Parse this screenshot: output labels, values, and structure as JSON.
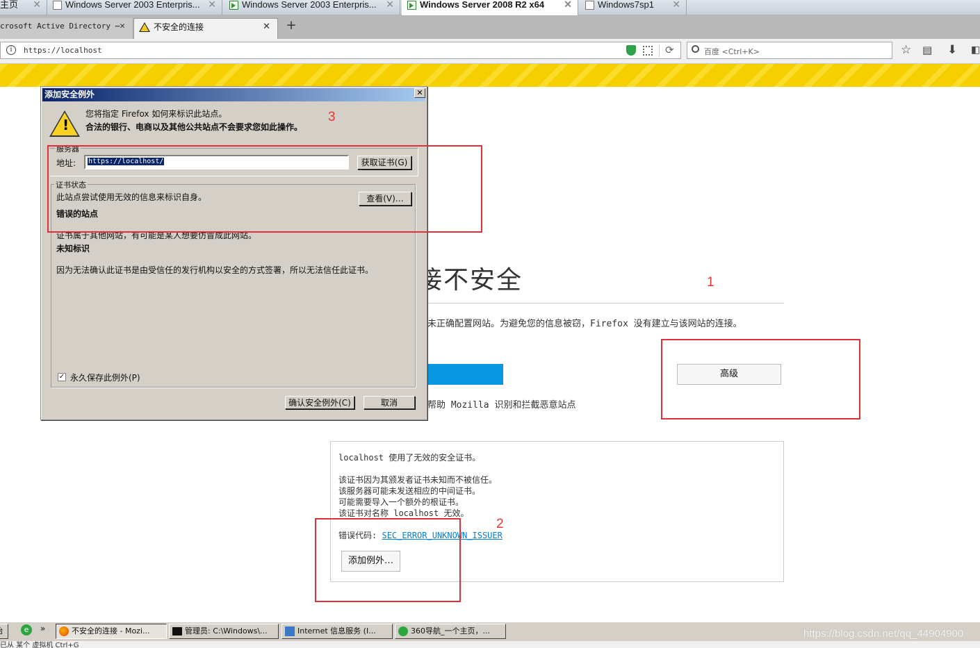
{
  "vm_tabs": [
    {
      "label": "主页"
    },
    {
      "label": "Windows Server 2003 Enterpris..."
    },
    {
      "label": "Windows Server 2003 Enterpris..."
    },
    {
      "label": "Windows Server 2008 R2 x64",
      "active": true
    },
    {
      "label": "Windows7sp1"
    }
  ],
  "browser_tabs": [
    {
      "label": "crosoft Active Directory ⋯"
    },
    {
      "label": "不安全的连接",
      "active": true
    }
  ],
  "new_tab_label": "+",
  "url_bar": {
    "url": "https://localhost"
  },
  "search_bar": {
    "placeholder": "百度 <Ctrl+K>"
  },
  "error_page": {
    "title_partial": "接不安全",
    "description_partial": "未正确配置网站。为避免您的信息被窃，Firefox 没有建立与该网站的连接。",
    "advanced_button": "高级",
    "report_partial": "帮助 Mozilla 识别和拦截恶意站点",
    "advanced_panel": {
      "line1": "localhost 使用了无效的安全证书。",
      "line2": "该证书因为其颁发者证书未知而不被信任。",
      "line3": "该服务器可能未发送相应的中间证书。",
      "line4": "可能需要导入一个额外的根证书。",
      "line5": "该证书对名称 localhost 无效。",
      "error_code_label": "错误代码:",
      "error_code": "SEC_ERROR_UNKNOWN_ISSUER",
      "add_exception_button": "添加例外…"
    }
  },
  "dialog": {
    "title": "添加安全例外",
    "close": "✕",
    "msg1": "您将指定 Firefox 如何来标识此站点。",
    "msg2": "合法的银行、电商以及其他公共站点不会要求您如此操作。",
    "server_group": "服务器",
    "address_label": "地址:",
    "address_value": "https://localhost/",
    "get_cert_button": "获取证书(G)",
    "cert_status_group": "证书状态",
    "status_text": "此站点尝试使用无效的信息来标识自身。",
    "view_button": "查看(V)…",
    "wrong_site_title": "错误的站点",
    "wrong_site_text": "证书属于其他网站，有可能是某人想要仿冒成此网站。",
    "unknown_id_title": "未知标识",
    "unknown_id_text": "因为无法确认此证书是由受信任的发行机构以安全的方式签署，所以无法信任此证书。",
    "permanent_checkbox": "永久保存此例外(P)",
    "permanent_checked": true,
    "confirm_button": "确认安全例外(C)",
    "cancel_button": "取消"
  },
  "annotations": [
    "1",
    "2",
    "3"
  ],
  "taskbar": {
    "start_partial": "始",
    "chevron": "»",
    "tasks": [
      {
        "label": "不安全的连接 - Mozi..."
      },
      {
        "label": "管理员: C:\\Windows\\..."
      },
      {
        "label": "Internet 信息服务 (I..."
      },
      {
        "label": "360导航_一个主页，..."
      }
    ]
  },
  "status_line": "已从 某个 虚拟机 Ctrl+G",
  "watermark": "https://blog.csdn.net/qq_44904900",
  "colors": {
    "accent_blue": "#0996e0",
    "annotation_red": "#e0303a",
    "warning_yellow": "#f5cf00",
    "dialog_title": "#0a246a"
  }
}
